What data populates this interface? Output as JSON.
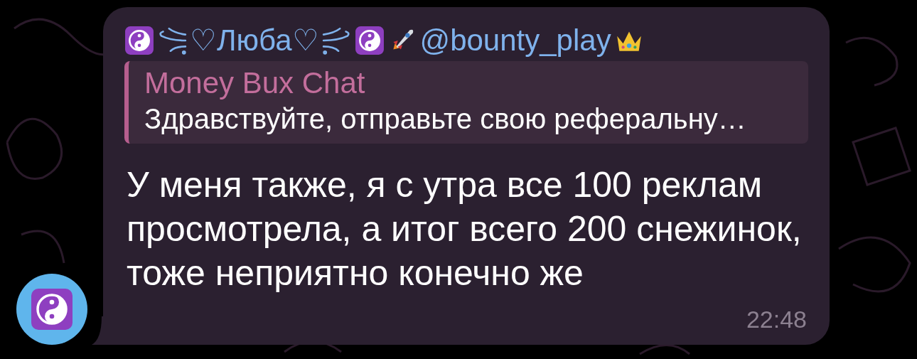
{
  "message": {
    "sender_name": "♡Люба♡",
    "sender_handle": "@bounty_play",
    "reply": {
      "title": "Money Bux Chat",
      "text": "Здравствуйте, отправьте свою реферальну…"
    },
    "text": "У меня также, я с утра все 100 реклам просмотрела, а итог всего 200 снежинок, тоже неприятно конечно же",
    "time": "22:48"
  }
}
